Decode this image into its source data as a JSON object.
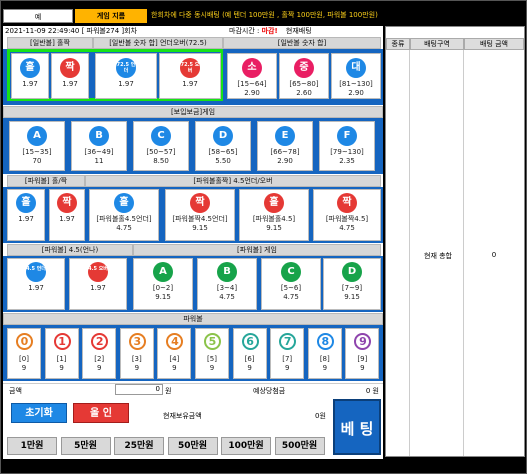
{
  "tabs": {
    "tab1": "예",
    "tab2": "게임 지름"
  },
  "notice": "한회차에 다중 동시배팅 (예 텐더 100만원 , 홀짝 100만원, 파워볼 100만원)",
  "info": {
    "datetime": "2021-11-09 22:49:40 [ 파워볼274 ]회차",
    "deadline_label": "마감시간 :",
    "deadline_value": "마감!",
    "current_label": "현재배팅"
  },
  "sections": {
    "s1a": "[일반볼] 홀짝",
    "s1b": "[일반볼 숫자 합] 언더오버(72.5)",
    "s1c": "[일반볼 숫자 합]",
    "s2": "[보입보금]게임",
    "s3a": "[파워볼] 홀/짝",
    "s3b": "[파워볼홀짝] 4.5언더/오버",
    "s4a": "[파워볼] 4.5(언나)",
    "s4b": "[파워볼] 게임",
    "s5": "파워볼"
  },
  "row1": [
    {
      "ball": "홀",
      "odds": "1.97",
      "color": "#1e88e5"
    },
    {
      "ball": "짝",
      "odds": "1.97",
      "color": "#e53935"
    },
    {
      "ball": "72.5 언더",
      "odds": "1.97",
      "color": "#1e88e5"
    },
    {
      "ball": "72.5 오버",
      "odds": "1.97",
      "color": "#e53935"
    },
    {
      "ball": "소",
      "range": "[15~64]",
      "odds": "2.90",
      "color": "#e91e63"
    },
    {
      "ball": "중",
      "range": "[65~80]",
      "odds": "2.60",
      "color": "#e91e63"
    },
    {
      "ball": "대",
      "range": "[81~130]",
      "odds": "2.90",
      "color": "#1e88e5"
    }
  ],
  "row2": [
    {
      "ball": "A",
      "range": "[15~35]",
      "odds": "70",
      "color": "#1e88e5"
    },
    {
      "ball": "B",
      "range": "[36~49]",
      "odds": "11",
      "color": "#1e88e5"
    },
    {
      "ball": "C",
      "range": "[50~57]",
      "odds": "8.50",
      "color": "#1e88e5"
    },
    {
      "ball": "D",
      "range": "[58~65]",
      "odds": "5.50",
      "color": "#1e88e5"
    },
    {
      "ball": "E",
      "range": "[66~78]",
      "odds": "2.90",
      "color": "#1e88e5"
    },
    {
      "ball": "F",
      "range": "[79~130]",
      "odds": "2.35",
      "color": "#1e88e5"
    }
  ],
  "row3": [
    {
      "ball": "홀",
      "odds": "1.97",
      "color": "#1e88e5"
    },
    {
      "ball": "짝",
      "odds": "1.97",
      "color": "#e53935"
    },
    {
      "ball": "홀",
      "label": "[파워볼홀4.5언더]",
      "odds": "4.75",
      "color": "#1e88e5"
    },
    {
      "ball": "짝",
      "label": "[파워볼짝4.5언더]",
      "odds": "9.15",
      "color": "#e53935"
    },
    {
      "ball": "홀",
      "label": "[파워볼홀4.5]",
      "odds": "9.15",
      "color": "#e53935"
    },
    {
      "ball": "짝",
      "label": "[파워볼짝4.5]",
      "odds": "4.75",
      "color": "#e53935"
    }
  ],
  "row4": [
    {
      "ball": "4.5 언더",
      "odds": "1.97",
      "color": "#1e88e5"
    },
    {
      "ball": "4.5 오버",
      "odds": "1.97",
      "color": "#e53935"
    },
    {
      "ball": "A",
      "range": "[0~2]",
      "odds": "9.15",
      "color": "#17a34a"
    },
    {
      "ball": "B",
      "range": "[3~4]",
      "odds": "4.75",
      "color": "#17a34a"
    },
    {
      "ball": "C",
      "range": "[5~6]",
      "odds": "4.75",
      "color": "#17a34a"
    },
    {
      "ball": "D",
      "range": "[7~9]",
      "odds": "9.15",
      "color": "#17a34a"
    }
  ],
  "row5": [
    {
      "n": "0",
      "r": "[0]",
      "o": "9",
      "c": "#e67e22"
    },
    {
      "n": "1",
      "r": "[1]",
      "o": "9",
      "c": "#e53935"
    },
    {
      "n": "2",
      "r": "[2]",
      "o": "9",
      "c": "#e53935"
    },
    {
      "n": "3",
      "r": "[3]",
      "o": "9",
      "c": "#e67e22"
    },
    {
      "n": "4",
      "r": "[4]",
      "o": "9",
      "c": "#e67e22"
    },
    {
      "n": "5",
      "r": "[5]",
      "o": "9",
      "c": "#8bc34a"
    },
    {
      "n": "6",
      "r": "[6]",
      "o": "9",
      "c": "#26a69a"
    },
    {
      "n": "7",
      "r": "[7]",
      "o": "9",
      "c": "#26a69a"
    },
    {
      "n": "8",
      "r": "[8]",
      "o": "9",
      "c": "#1e88e5"
    },
    {
      "n": "9",
      "r": "[9]",
      "o": "9",
      "c": "#8e44ad"
    }
  ],
  "bet": {
    "amount_label": "금액",
    "amount_value": "0",
    "unit": "원",
    "expected_label": "예상당첨금",
    "expected_value": "0 원",
    "reset": "초기화",
    "allin": "올 인",
    "holding_label": "현재보유금액",
    "holding_value": "0원",
    "bet_btn": "베 팅"
  },
  "amounts": [
    "1만원",
    "5만원",
    "25만원",
    "50만원",
    "100만원",
    "500만원"
  ],
  "right": {
    "h1": "종류",
    "h2": "배팅구역",
    "h3": "배팅 금액",
    "total_label": "현재 총합",
    "total_value": "0"
  }
}
